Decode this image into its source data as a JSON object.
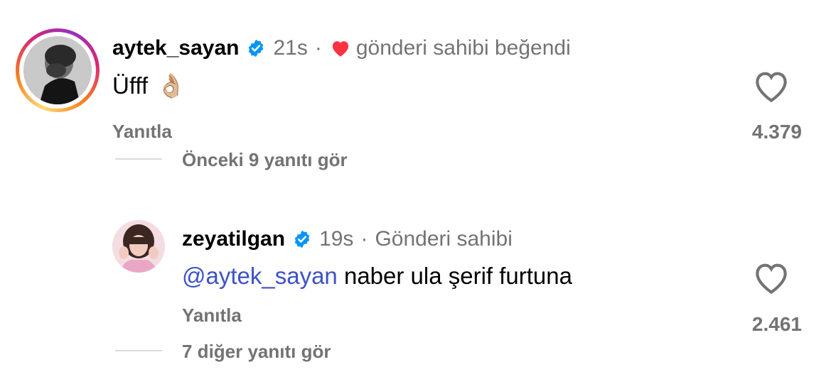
{
  "comments": [
    {
      "username": "aytek_sayan",
      "time": "21s",
      "separator": "·",
      "liked_by_author": "gönderi sahibi beğendi",
      "text": "Üfff",
      "emoji": "👌🏼",
      "reply_label": "Yanıtla",
      "like_count": "4.379",
      "view_replies": "Önceki 9 yanıtı gör"
    },
    {
      "username": "zeyatilgan",
      "time": "19s",
      "separator": "·",
      "author_badge": "Gönderi sahibi",
      "mention": "@aytek_sayan",
      "text": " naber ula şerif furtuna",
      "reply_label": "Yanıtla",
      "like_count": "2.461",
      "view_replies": "7 diğer yanıtı gör"
    }
  ],
  "icons": {
    "verified": "verified-badge-icon",
    "liked": "red-heart-icon",
    "like": "heart-outline-icon"
  },
  "colors": {
    "verified": "#0095f6",
    "heart_red": "#ff3040",
    "mention": "#3d52c8",
    "muted": "#737373"
  }
}
